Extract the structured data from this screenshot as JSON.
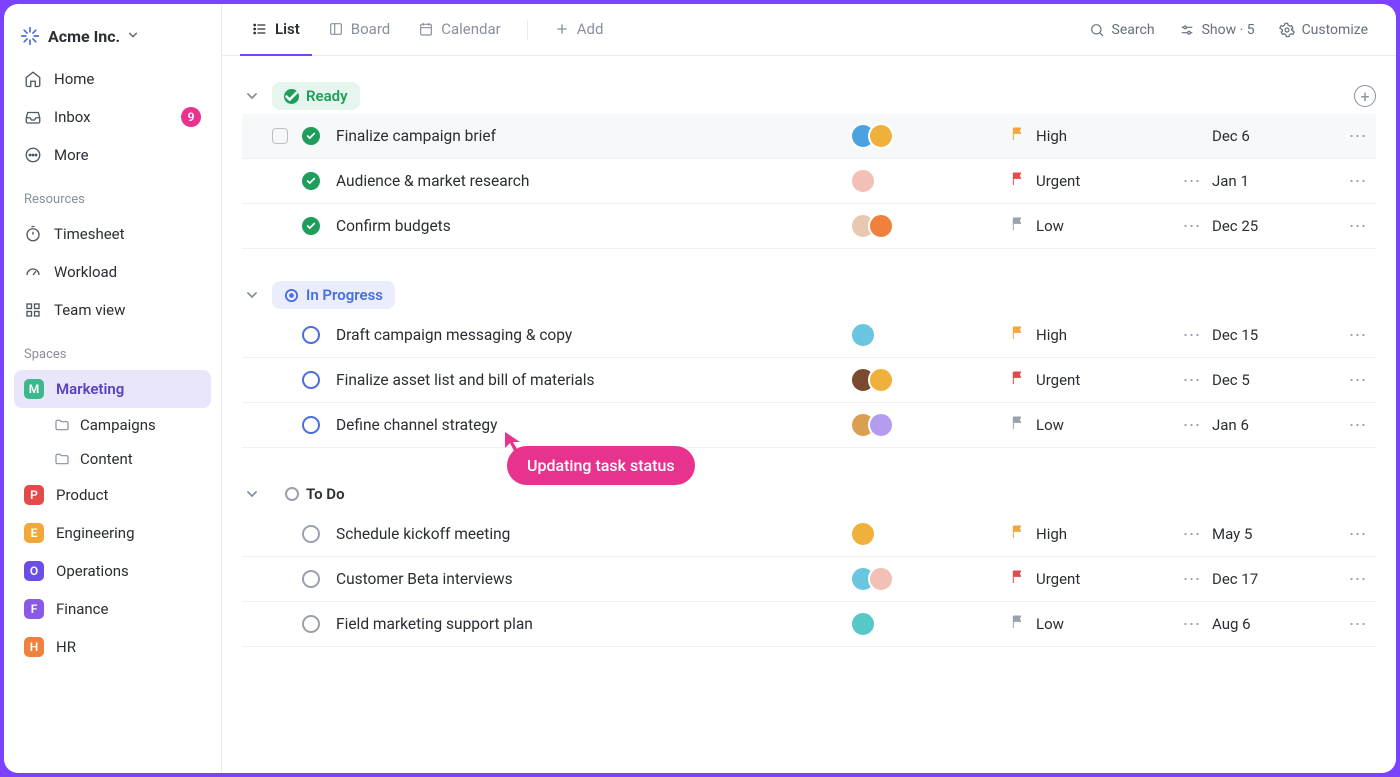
{
  "workspace": {
    "name": "Acme Inc."
  },
  "sidebar": {
    "home": "Home",
    "inbox": "Inbox",
    "inbox_badge": "9",
    "more": "More",
    "resources_label": "Resources",
    "timesheet": "Timesheet",
    "workload": "Workload",
    "teamview": "Team view",
    "spaces_label": "Spaces",
    "spaces": [
      {
        "letter": "M",
        "label": "Marketing",
        "color": "#3db88d",
        "active": true
      },
      {
        "letter": "P",
        "label": "Product",
        "color": "#e44a4a"
      },
      {
        "letter": "E",
        "label": "Engineering",
        "color": "#f2a73b"
      },
      {
        "letter": "O",
        "label": "Operations",
        "color": "#6b4ee6"
      },
      {
        "letter": "F",
        "label": "Finance",
        "color": "#8a5ae6"
      },
      {
        "letter": "H",
        "label": "HR",
        "color": "#f0813c"
      }
    ],
    "folders": [
      {
        "label": "Campaigns"
      },
      {
        "label": "Content"
      }
    ]
  },
  "views": {
    "list": "List",
    "board": "Board",
    "calendar": "Calendar",
    "add": "Add"
  },
  "topbar": {
    "search": "Search",
    "show": "Show · 5",
    "customize": "Customize"
  },
  "tooltip": "Updating task status",
  "groups": [
    {
      "id": "ready",
      "label": "Ready",
      "chip_bg": "#e6f6ee",
      "chip_color": "#1e9e5a",
      "status_class": "ts-ready",
      "show_add": true,
      "tasks": [
        {
          "title": "Finalize campaign brief",
          "hover": true,
          "avatars": [
            "#4aa3e0",
            "#f0b13c"
          ],
          "priority": "High",
          "flag": "#f2a73b",
          "due": "Dec 6",
          "tribar": false
        },
        {
          "title": "Audience & market research",
          "avatars": [
            "#f2c0b4"
          ],
          "priority": "Urgent",
          "flag": "#e44a4a",
          "due": "Jan 1",
          "tribar": true
        },
        {
          "title": "Confirm budgets",
          "avatars": [
            "#e8c8b0",
            "#f0813c"
          ],
          "priority": "Low",
          "flag": "#9aa0ac",
          "due": "Dec 25",
          "tribar": true
        }
      ]
    },
    {
      "id": "inprogress",
      "label": "In Progress",
      "chip_bg": "#eaeefc",
      "chip_color": "#4a6ee0",
      "status_class": "ts-inprogress",
      "tasks": [
        {
          "title": "Draft campaign messaging & copy",
          "avatars": [
            "#6ac6e0"
          ],
          "priority": "High",
          "flag": "#f2a73b",
          "due": "Dec 15",
          "tribar": true
        },
        {
          "title": "Finalize asset list and bill of materials",
          "avatars": [
            "#7a4a2e",
            "#f0b13c"
          ],
          "priority": "Urgent",
          "flag": "#e44a4a",
          "due": "Dec 5",
          "tribar": true
        },
        {
          "title": "Define channel strategy",
          "avatars": [
            "#d8a050",
            "#b59cf0"
          ],
          "priority": "Low",
          "flag": "#9aa0ac",
          "due": "Jan 6",
          "tribar": true
        }
      ]
    },
    {
      "id": "todo",
      "label": "To Do",
      "chip_bg": "transparent",
      "chip_color": "#2a2e34",
      "status_class": "ts-todo",
      "tasks": [
        {
          "title": "Schedule kickoff meeting",
          "avatars": [
            "#f0b13c"
          ],
          "priority": "High",
          "flag": "#f2a73b",
          "due": "May 5",
          "tribar": true
        },
        {
          "title": "Customer Beta interviews",
          "avatars": [
            "#6ac6e0",
            "#f2c0b4"
          ],
          "priority": "Urgent",
          "flag": "#e44a4a",
          "due": "Dec 17",
          "tribar": true
        },
        {
          "title": "Field marketing support plan",
          "avatars": [
            "#56c8c8"
          ],
          "priority": "Low",
          "flag": "#9aa0ac",
          "due": "Aug 6",
          "tribar": true
        }
      ]
    }
  ]
}
